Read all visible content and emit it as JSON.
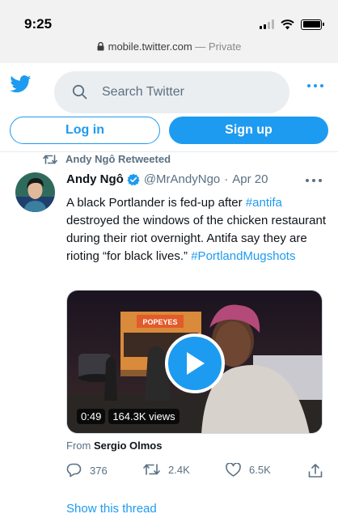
{
  "status_bar": {
    "time": "9:25"
  },
  "browser": {
    "url": "mobile.twitter.com",
    "separator": " — ",
    "mode": "Private"
  },
  "header": {
    "search_placeholder": "Search Twitter",
    "login_label": "Log in",
    "signup_label": "Sign up"
  },
  "tweet": {
    "retweeted_by": "Andy Ngô Retweeted",
    "author_name": "Andy Ngô",
    "handle": "@MrAndyNgo",
    "separator": "·",
    "date": "Apr 20",
    "text_1": "A black Portlander is fed-up after ",
    "hashtag_1": "#antifa",
    "text_2": " destroyed the windows of the chicken restaurant during their riot overnight. Antifa say they are rioting “for black lives.” ",
    "hashtag_2": "#PortlandMugshots",
    "video_duration": "0:49",
    "video_views": "164.3K views",
    "sign_text": "POPEYES",
    "from_label": "From ",
    "from_source": "Sergio Olmos",
    "replies": "376",
    "retweets": "2.4K",
    "likes": "6.5K",
    "show_thread": "Show this thread"
  },
  "colors": {
    "accent": "#1d9bf0",
    "muted": "#5b7083",
    "search_bg": "#ebeef0"
  },
  "icons": [
    "bird-icon",
    "search-icon",
    "more-icon",
    "retweet-icon",
    "verified-icon",
    "play-icon",
    "reply-icon",
    "like-icon",
    "share-icon",
    "lock-icon"
  ]
}
